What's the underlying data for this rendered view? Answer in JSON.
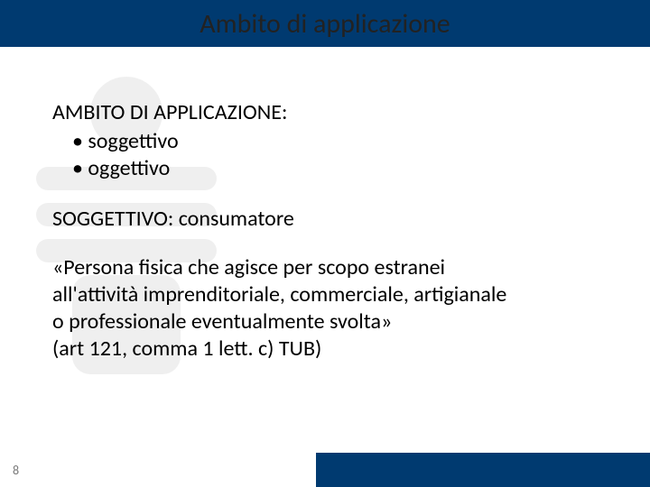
{
  "title": "Ambito di applicazione",
  "heading": "AMBITO DI APPLICAZIONE:",
  "bullets": [
    "soggettivo",
    "oggettivo"
  ],
  "sub1": "SOGGETTIVO: consumatore",
  "quote_l1": "«Persona fisica che agisce per scopo estranei",
  "quote_l2": "all'attività imprenditoriale, commerciale, artigianale",
  "quote_l3": "o professionale eventualmente svolta»",
  "cite": "(art 121, comma 1 lett. c) TUB)",
  "page": "8"
}
